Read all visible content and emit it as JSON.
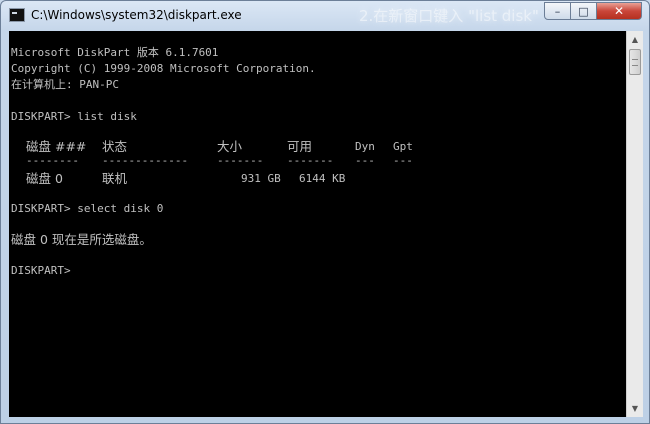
{
  "window": {
    "title": "C:\\Windows\\system32\\diskpart.exe",
    "overlay_text": "2.在新窗口键入 \"list disk\"",
    "controls": {
      "minimize": "–",
      "maximize": "□",
      "close": "✕"
    }
  },
  "console": {
    "header": [
      "Microsoft DiskPart 版本 6.1.7601",
      "Copyright (C) 1999-2008 Microsoft Corporation.",
      "在计算机上: PAN-PC"
    ],
    "cmd1": "DISKPART> list disk",
    "table": {
      "headers": [
        "磁盘 ###",
        "状态",
        "大小",
        "可用",
        "Dyn",
        "Gpt"
      ],
      "separators": [
        "--------",
        "-------------",
        "-------",
        "-------",
        "---",
        "---"
      ],
      "rows": [
        [
          "磁盘 0",
          "联机",
          "931 GB",
          "6144 KB",
          "",
          ""
        ]
      ]
    },
    "cmd2": "DISKPART> select disk 0",
    "result": "磁盘 0 现在是所选磁盘。",
    "prompt": "DISKPART>"
  },
  "scrollbar": {
    "up_arrow": "▲",
    "down_arrow": "▼"
  }
}
